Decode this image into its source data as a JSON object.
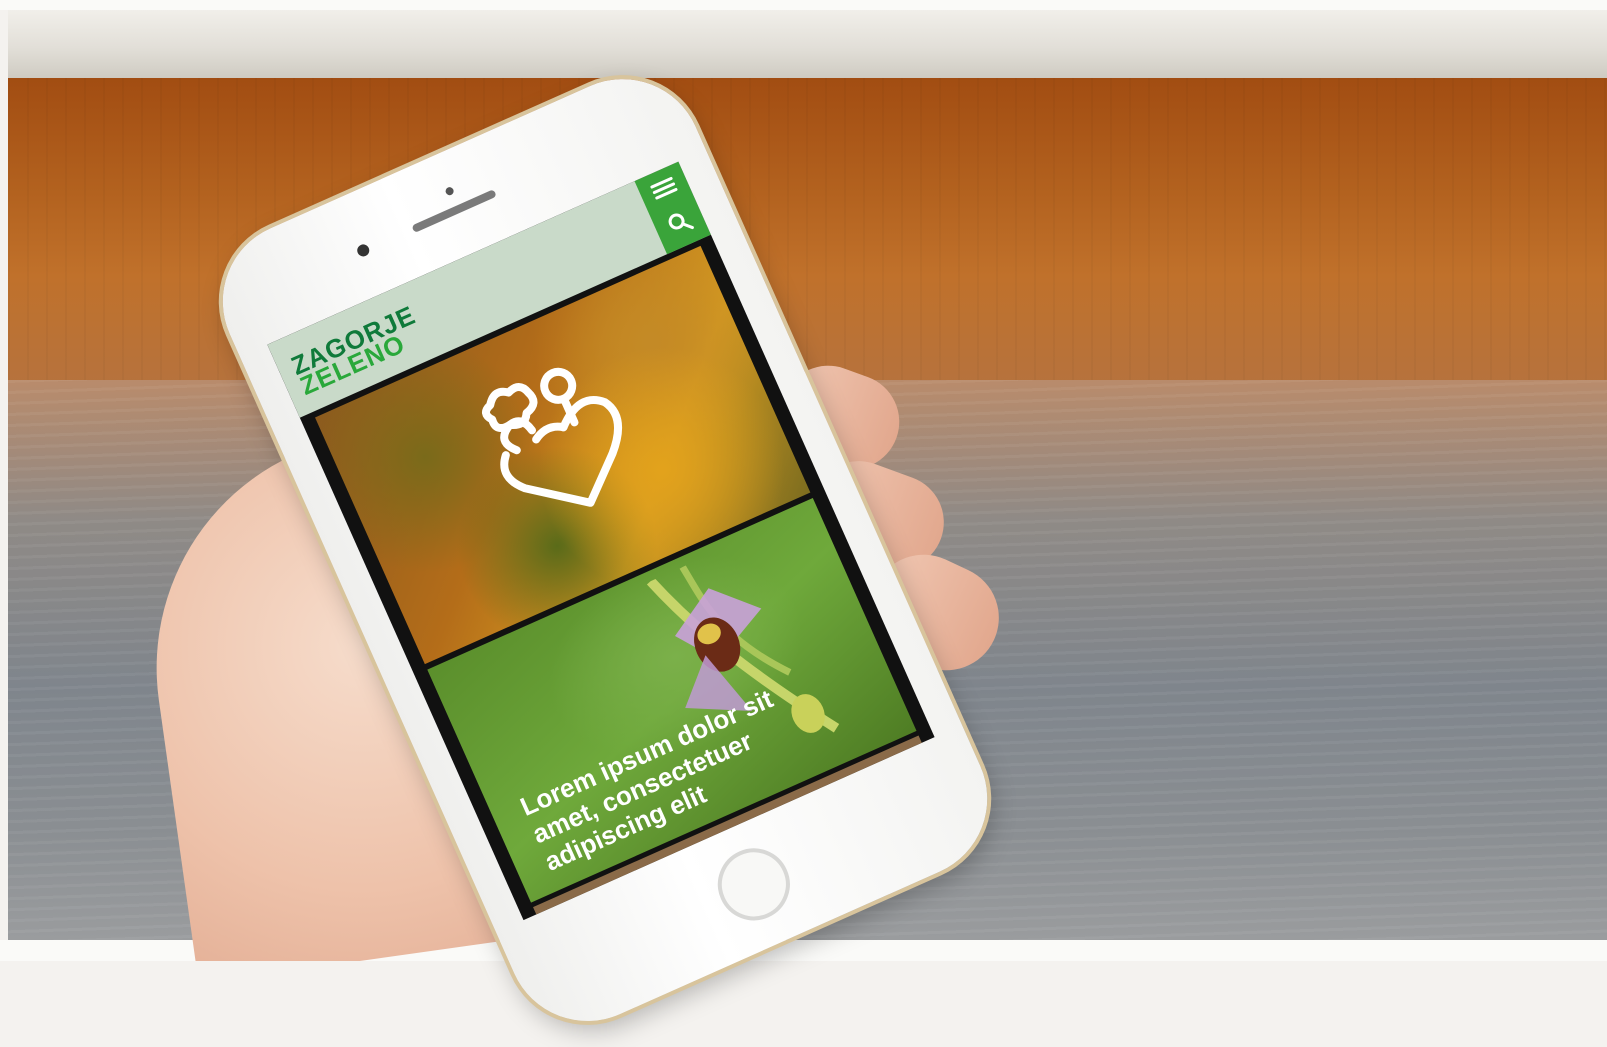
{
  "site": {
    "logo_line1": "ZAGORJE",
    "logo_line2": "ZELENO",
    "brand_green": "#0f7a3a",
    "accent_green": "#3aa43a"
  },
  "header": {
    "menu_icon": "hamburger-menu-icon",
    "search_icon": "search-icon"
  },
  "hero": {
    "icon": "heart-flower-logo-icon"
  },
  "featured_card": {
    "title": "Lorem ipsum dolor sit amet, consectetuer adipiscing elit"
  }
}
